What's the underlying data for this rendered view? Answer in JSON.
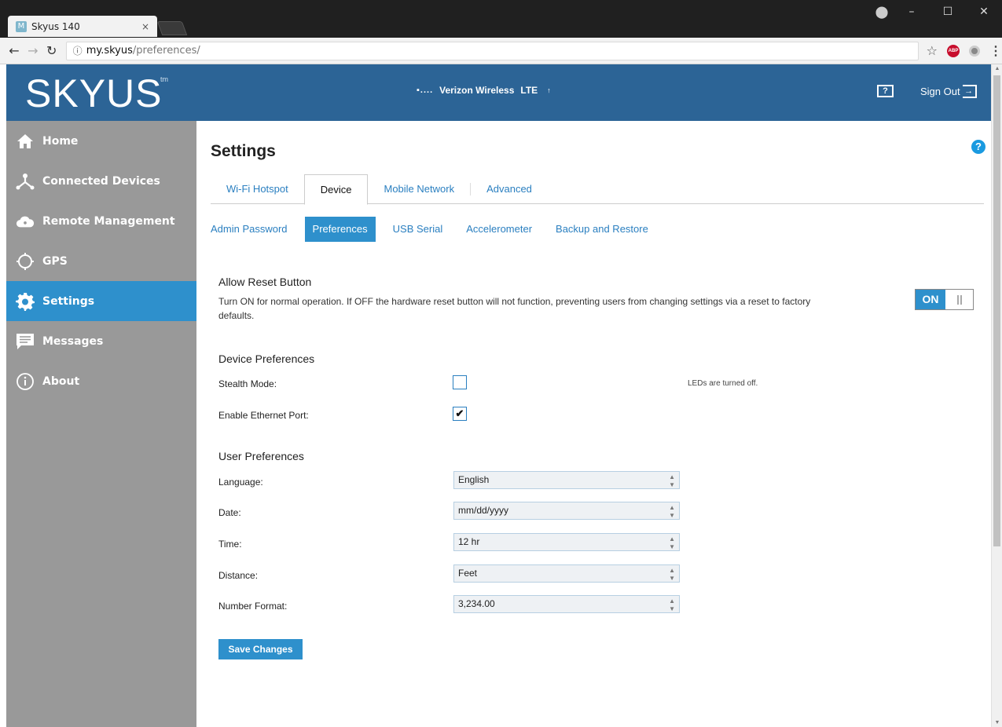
{
  "browser": {
    "tab_title": "Skyus 140",
    "tab_favicon": "M",
    "tab_close": "×",
    "url_host": "my.skyus",
    "url_path": "/preferences/",
    "window_controls": [
      "–",
      "☐",
      "✕"
    ]
  },
  "header": {
    "logo": "SKYUS",
    "logo_tm": "tm",
    "signal": "▪....",
    "carrier": "Verizon Wireless",
    "network": "LTE",
    "help_icon": "?",
    "signout": "Sign Out"
  },
  "sidebar": {
    "items": [
      {
        "label": "Home",
        "icon": "home-icon"
      },
      {
        "label": "Connected Devices",
        "icon": "connected-devices-icon"
      },
      {
        "label": "Remote Management",
        "icon": "cloud-icon"
      },
      {
        "label": "GPS",
        "icon": "gps-icon"
      },
      {
        "label": "Settings",
        "icon": "gear-icon",
        "active": true
      },
      {
        "label": "Messages",
        "icon": "message-icon"
      },
      {
        "label": "About",
        "icon": "info-icon"
      }
    ]
  },
  "main": {
    "title": "Settings",
    "help_icon": "?",
    "tabs": [
      "Wi-Fi Hotspot",
      "Device",
      "Mobile Network",
      "Advanced"
    ],
    "active_tab": "Device",
    "subtabs": [
      "Admin Password",
      "Preferences",
      "USB Serial",
      "Accelerometer",
      "Backup and Restore"
    ],
    "active_subtab": "Preferences",
    "reset": {
      "title": "Allow Reset Button",
      "description": "Turn ON for normal operation. If OFF the hardware reset button will not function, preventing users from changing settings via a reset to factory defaults.",
      "toggle_label": "ON"
    },
    "device_prefs": {
      "title": "Device Preferences",
      "stealth_label": "Stealth Mode:",
      "stealth_checked": false,
      "stealth_hint": "LEDs are turned off.",
      "ethernet_label": "Enable Ethernet Port:",
      "ethernet_checked": true,
      "check_mark": "✔"
    },
    "user_prefs": {
      "title": "User Preferences",
      "fields": [
        {
          "label": "Language:",
          "value": "English"
        },
        {
          "label": "Date:",
          "value": "mm/dd/yyyy"
        },
        {
          "label": "Time:",
          "value": "12 hr"
        },
        {
          "label": "Distance:",
          "value": "Feet"
        },
        {
          "label": "Number Format:",
          "value": "3,234.00"
        }
      ]
    },
    "save_label": "Save Changes"
  },
  "colors": {
    "header_blue": "#2c6496",
    "accent_blue": "#2e90cc",
    "sidebar_gray": "#999999"
  }
}
